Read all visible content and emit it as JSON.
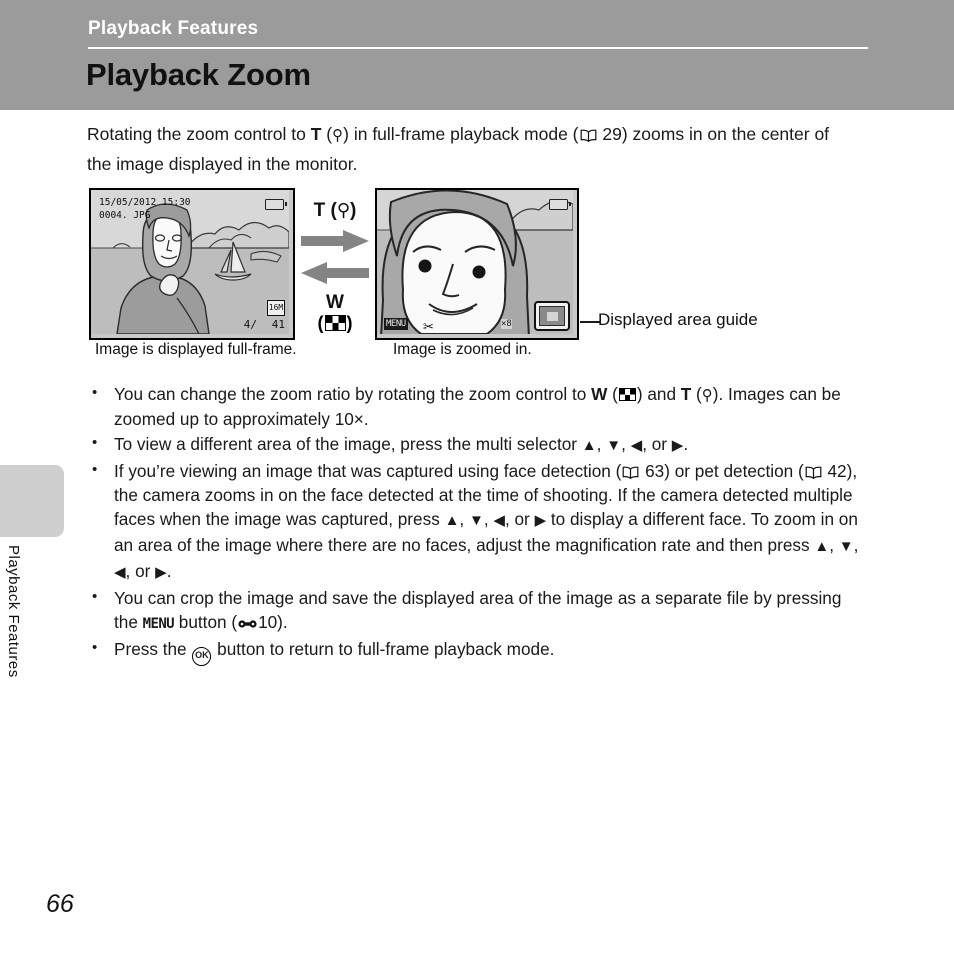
{
  "header": {
    "section_title": "Playback Features",
    "page_title": "Playback Zoom"
  },
  "side_tab": {
    "label": "Playback Features"
  },
  "intro": {
    "text_part1": "Rotating the zoom control to ",
    "t_label": "T",
    "magnify_open": " (",
    "magnify_icon": "magnifier-icon",
    "magnify_close": ") in full-frame playback mode (",
    "ref_icon": "book-icon",
    "ref_page": "29",
    "text_part2": ") zooms in on the center of the image displayed in the monitor."
  },
  "figure": {
    "left_lcd": {
      "date": "15/05/2012  15:30",
      "filename": "0004. JPG",
      "frame_index": "4/",
      "frame_total": "41",
      "image_size_badge": "16M",
      "battery_icon": "battery-icon"
    },
    "zoom_control": {
      "t_label": "T",
      "t_icon_open": "(",
      "t_icon": "magnifier-icon",
      "t_icon_close": ")",
      "arrow_right": "arrow-right-icon",
      "arrow_left": "arrow-left-icon",
      "w_label": "W",
      "w_icon_open": "(",
      "w_icon": "thumbnail-grid-icon",
      "w_icon_close": ")"
    },
    "right_lcd": {
      "menu_badge": "MENU",
      "crop_icon": "scissors-icon",
      "zoom_factor": "×8",
      "battery_icon": "battery-icon",
      "area_guide_icon": "displayed-area-guide-icon"
    },
    "caption_left": "Image is displayed full-frame.",
    "caption_right": "Image is zoomed in.",
    "callout_label": "Displayed area guide"
  },
  "bullets": [
    {
      "id": "zoom-ratio",
      "segments": [
        {
          "t": "text",
          "v": "You can change the zoom ratio by rotating the zoom control to "
        },
        {
          "t": "bold",
          "v": "W"
        },
        {
          "t": "text",
          "v": " ("
        },
        {
          "t": "icon",
          "v": "thumbnail-grid-icon"
        },
        {
          "t": "text",
          "v": ") and "
        },
        {
          "t": "bold",
          "v": "T"
        },
        {
          "t": "text",
          "v": " ("
        },
        {
          "t": "icon",
          "v": "magnifier-icon"
        },
        {
          "t": "text",
          "v": "). Images can be zoomed up to approximately 10×."
        }
      ]
    },
    {
      "id": "multi-selector",
      "segments": [
        {
          "t": "text",
          "v": "To view a different area of the image, press the multi selector "
        },
        {
          "t": "icon",
          "v": "triangle-up-icon"
        },
        {
          "t": "text",
          "v": ", "
        },
        {
          "t": "icon",
          "v": "triangle-down-icon"
        },
        {
          "t": "text",
          "v": ", "
        },
        {
          "t": "icon",
          "v": "triangle-left-icon"
        },
        {
          "t": "text",
          "v": ", or "
        },
        {
          "t": "icon",
          "v": "triangle-right-icon"
        },
        {
          "t": "text",
          "v": "."
        }
      ]
    },
    {
      "id": "face-detection",
      "segments": [
        {
          "t": "text",
          "v": "If you’re viewing an image that was captured using face detection ("
        },
        {
          "t": "icon",
          "v": "book-icon"
        },
        {
          "t": "text",
          "v": " 63) or pet detection ("
        },
        {
          "t": "icon",
          "v": "book-icon"
        },
        {
          "t": "text",
          "v": " 42), the camera zooms in on the face detected at the time of shooting. If the camera detected multiple faces when the image was captured, press "
        },
        {
          "t": "icon",
          "v": "triangle-up-icon"
        },
        {
          "t": "text",
          "v": ", "
        },
        {
          "t": "icon",
          "v": "triangle-down-icon"
        },
        {
          "t": "text",
          "v": ", "
        },
        {
          "t": "icon",
          "v": "triangle-left-icon"
        },
        {
          "t": "text",
          "v": ", or "
        },
        {
          "t": "icon",
          "v": "triangle-right-icon"
        },
        {
          "t": "text",
          "v": " to display a different face. To zoom in on an area of the image where there are no faces, adjust the magnification rate and then press "
        },
        {
          "t": "icon",
          "v": "triangle-up-icon"
        },
        {
          "t": "text",
          "v": ", "
        },
        {
          "t": "icon",
          "v": "triangle-down-icon"
        },
        {
          "t": "text",
          "v": ", "
        },
        {
          "t": "icon",
          "v": "triangle-left-icon"
        },
        {
          "t": "text",
          "v": ", or "
        },
        {
          "t": "icon",
          "v": "triangle-right-icon"
        },
        {
          "t": "text",
          "v": "."
        }
      ]
    },
    {
      "id": "crop-image",
      "segments": [
        {
          "t": "text",
          "v": "You can crop the image and save the displayed area of the image as a separate file by pressing the "
        },
        {
          "t": "menu",
          "v": "MENU"
        },
        {
          "t": "text",
          "v": " button ("
        },
        {
          "t": "icon",
          "v": "bone-ref-icon"
        },
        {
          "t": "text",
          "v": "10)."
        }
      ]
    },
    {
      "id": "return-full-frame",
      "segments": [
        {
          "t": "text",
          "v": "Press the "
        },
        {
          "t": "icon",
          "v": "ok-button-icon"
        },
        {
          "t": "text",
          "v": " button to return to full-frame playback mode."
        }
      ]
    }
  ],
  "page_number": "66",
  "colors": {
    "header_band": "#9b9b9b",
    "side_tab": "#cfcfcf",
    "text": "#1a1a1a",
    "lcd_background": "#c9c9c9"
  }
}
